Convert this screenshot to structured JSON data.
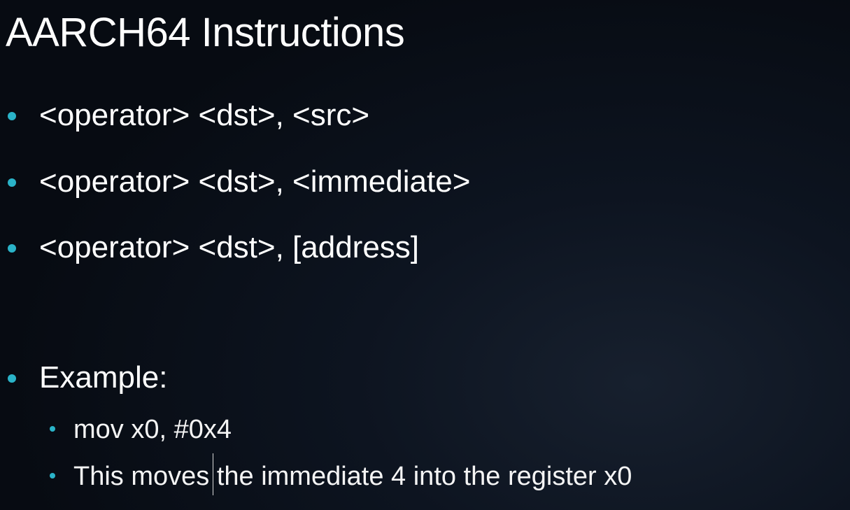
{
  "slide": {
    "title": "AARCH64 Instructions",
    "bullets": [
      {
        "text": "<operator> <dst>, <src>"
      },
      {
        "text": "<operator> <dst>, <immediate>"
      },
      {
        "text": "<operator> <dst>, [address]"
      },
      {
        "text": "Example:"
      }
    ],
    "sub_bullets": [
      {
        "text": "mov x0, #0x4"
      },
      {
        "text": "This moves the immediate 4 into the register x0"
      }
    ]
  },
  "colors": {
    "bullet": "#2ab3c8",
    "text": "#ffffff",
    "background": "#0d1420"
  }
}
